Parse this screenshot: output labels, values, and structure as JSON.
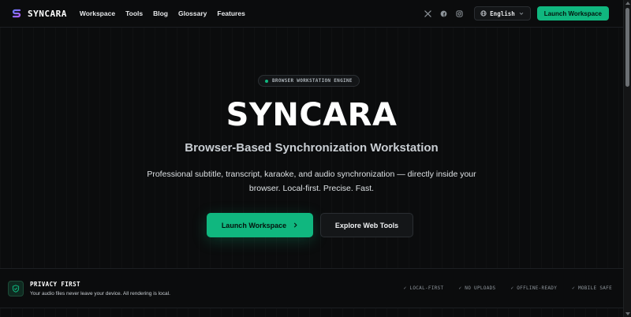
{
  "brand": {
    "name": "SYNCARA",
    "color": "#10b77f"
  },
  "nav": {
    "links": [
      "Workspace",
      "Tools",
      "Blog",
      "Glossary",
      "Features"
    ],
    "social": [
      "x-icon",
      "facebook-icon",
      "instagram-icon"
    ],
    "language": "English",
    "cta": "Launch Workspace"
  },
  "hero": {
    "badge": "BROWSER WORKSTATION ENGINE",
    "title": "SYNCARA",
    "subtitle": "Browser-Based Synchronization Workstation",
    "description": "Professional subtitle, transcript, karaoke, and audio synchronization — directly inside your browser. Local-first. Precise. Fast.",
    "primary_cta": "Launch Workspace",
    "secondary_cta": "Explore Web Tools"
  },
  "privacy": {
    "title": "PRIVACY FIRST",
    "description": "Your audio files never leave your device. All rendering is local.",
    "features": [
      "✓ LOCAL-FIRST",
      "✓ NO UPLOADS",
      "✓ OFFLINE-READY",
      "✓ MOBILE SAFE"
    ]
  }
}
